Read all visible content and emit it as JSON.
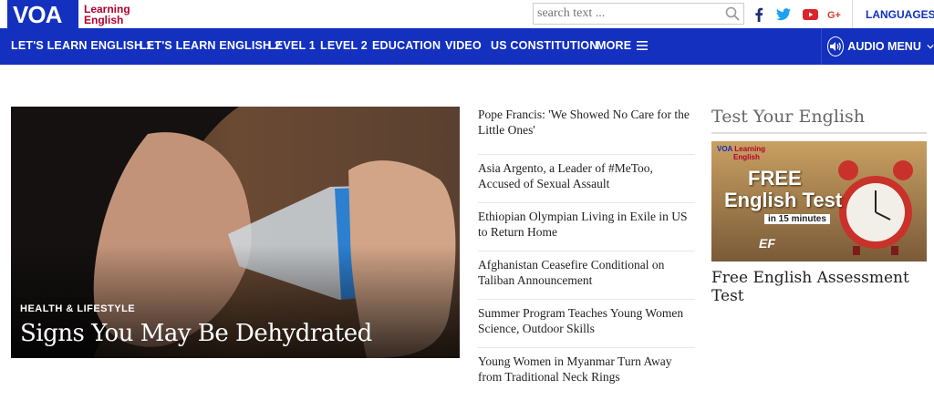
{
  "brand": {
    "logo_mark": "VOA",
    "logo_line1": "Learning",
    "logo_line2": "English"
  },
  "search": {
    "placeholder": "search text ..."
  },
  "social": [
    "facebook-icon",
    "twitter-icon",
    "youtube-icon",
    "google-plus-icon"
  ],
  "languages_label": "LANGUAGES",
  "nav": {
    "items": [
      "LET'S LEARN ENGLISH 1",
      "LET'S LEARN ENGLISH 2",
      "LEVEL 1",
      "LEVEL 2",
      "EDUCATION",
      "VIDEO",
      "US CONSTITUTION",
      "MORE"
    ],
    "audio_menu": "AUDIO MENU"
  },
  "hero": {
    "kicker": "HEALTH & LIFESTYLE",
    "title": "Signs You May Be Dehydrated"
  },
  "headlines": [
    [
      "Pope Francis: 'We Showed No Care for the",
      "Little Ones'"
    ],
    [
      "Asia Argento, a Leader of #MeToo,",
      "Accused of Sexual Assault"
    ],
    [
      "Ethiopian Olympian Living in Exile in US",
      "to Return Home"
    ],
    [
      "Afghanistan Ceasefire Conditional on",
      "Taliban Announcement"
    ],
    [
      "Summer Program Teaches Young Women",
      "Science, Outdoor Skills"
    ],
    [
      "Young Women in Myanmar Turn Away",
      "from Traditional Neck Rings"
    ]
  ],
  "sidebar": {
    "title": "Test Your English",
    "promo": {
      "brand_mark": "VOA",
      "brand_line1": "Learning",
      "brand_line2": "English",
      "line1": "FREE",
      "line2": "English Test",
      "line3": "in 15 minutes",
      "partner": "EF"
    },
    "caption": "Free English Assessment Test"
  },
  "colors": {
    "brand_blue": "#1330bf",
    "brand_red": "#b3002d"
  }
}
